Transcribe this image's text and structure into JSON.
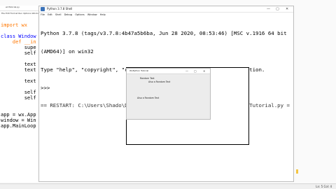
{
  "editor": {
    "title": "wxTutorial.py",
    "menu": [
      "File",
      "Edit",
      "Format",
      "Run",
      "Options",
      "Window",
      "Help"
    ],
    "lines": [
      {
        "kind": "kw",
        "text": "import wx"
      },
      {
        "kind": "blank",
        "text": ""
      },
      {
        "kind": "cl",
        "text": "class Window"
      },
      {
        "kind": "kw",
        "text": "    def __in"
      },
      {
        "kind": "txt",
        "text": "        supe"
      },
      {
        "kind": "txt",
        "text": "        self"
      },
      {
        "kind": "blank",
        "text": ""
      },
      {
        "kind": "txt",
        "text": "        text"
      },
      {
        "kind": "txt",
        "text": "        text"
      },
      {
        "kind": "blank",
        "text": ""
      },
      {
        "kind": "txt",
        "text": "        text"
      },
      {
        "kind": "blank",
        "text": ""
      },
      {
        "kind": "txt",
        "text": "        self"
      },
      {
        "kind": "txt",
        "text": "        self"
      },
      {
        "kind": "blank",
        "text": ""
      },
      {
        "kind": "blank",
        "text": ""
      },
      {
        "kind": "txt",
        "text": "app = wx.App"
      },
      {
        "kind": "txt",
        "text": "window = Win"
      },
      {
        "kind": "txt",
        "text": "app.MainLoop"
      }
    ]
  },
  "shell": {
    "title": "Python 3.7.8 Shell",
    "menu": [
      "File",
      "Edit",
      "Shell",
      "Debug",
      "Options",
      "Window",
      "Help"
    ],
    "controls": {
      "min": "—",
      "max": "▢",
      "close": "✕"
    },
    "lines": [
      "Python 3.7.8 (tags/v3.7.8:4b47a5b6ba, Jun 28 2020, 08:53:46) [MSC v.1916 64 bit",
      "(AMD64)] on win32",
      "Type \"help\", \"copyright\", \"credits\" or \"license()\" for more information.",
      ">>>",
      "== RESTART: C:\\Users\\Shado\\Desktop\\pyprograms\\WxPython\\Tutorials\\wxTutorial.py ="
    ]
  },
  "app": {
    "title": "WxPython Tutorial",
    "controls": {
      "min": "—",
      "max": "▢",
      "close": "✕"
    },
    "labels": [
      "Random Text",
      "Also a Random Text",
      "Also a Random Text"
    ]
  },
  "status": {
    "position": "Ln: 5 Col: 4"
  }
}
